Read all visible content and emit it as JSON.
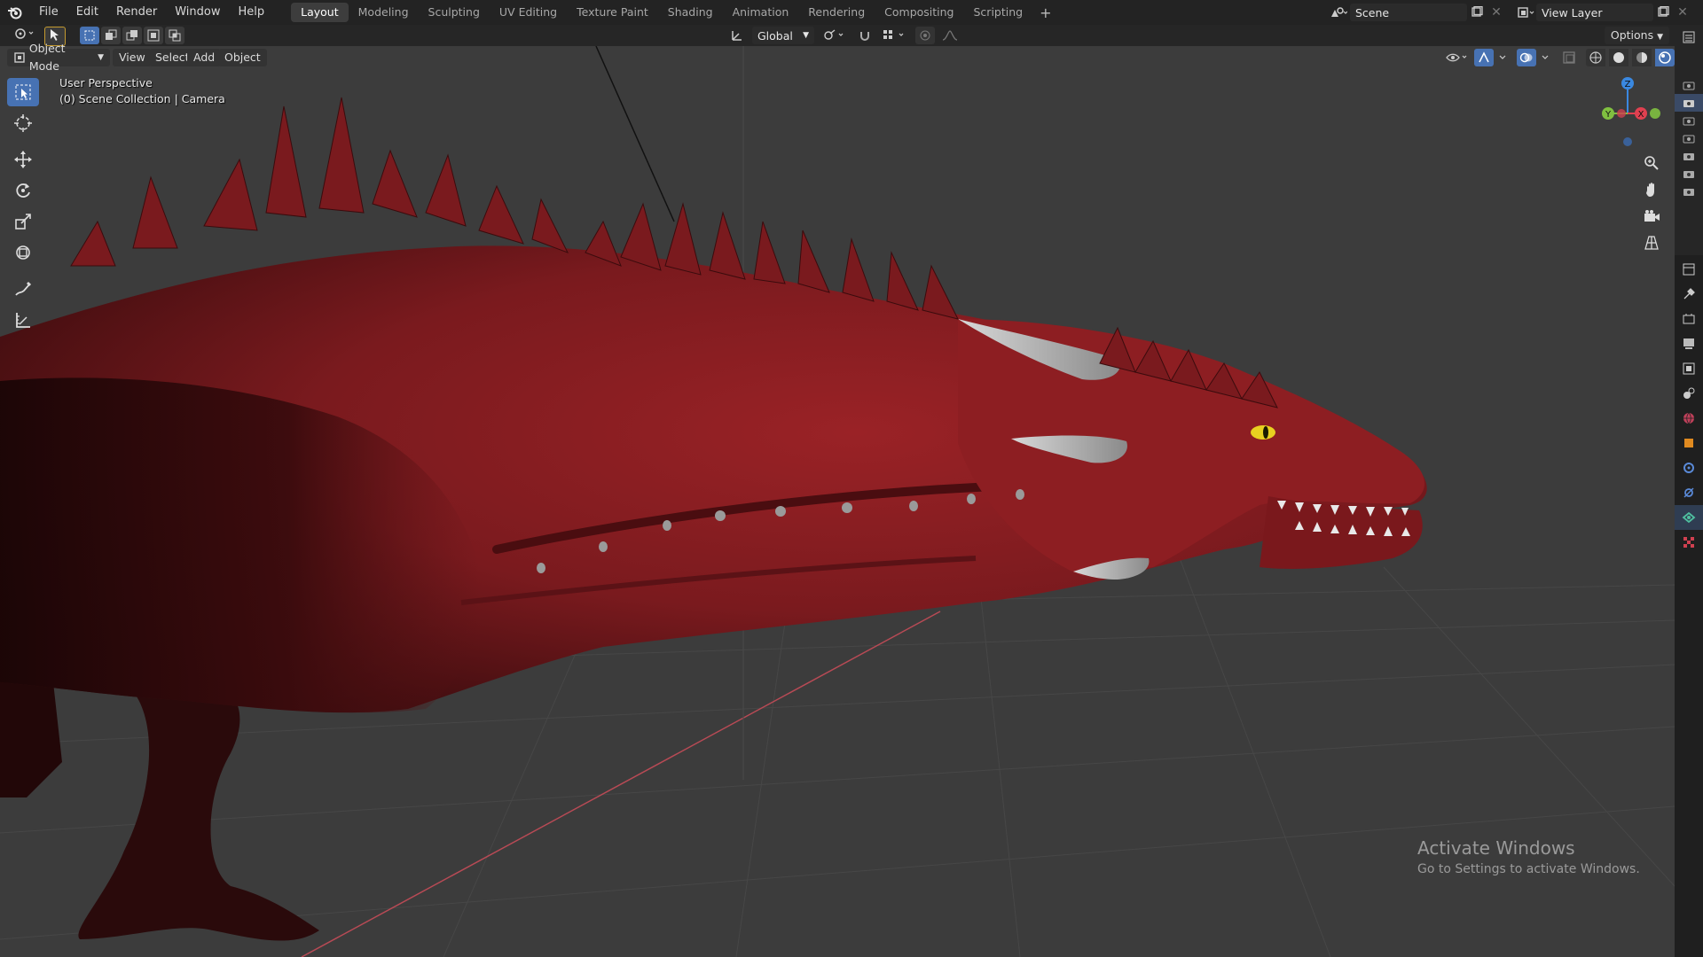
{
  "menus": [
    "File",
    "Edit",
    "Render",
    "Window",
    "Help"
  ],
  "workspace_tabs": [
    "Layout",
    "Modeling",
    "Sculpting",
    "UV Editing",
    "Texture Paint",
    "Shading",
    "Animation",
    "Rendering",
    "Compositing",
    "Scripting"
  ],
  "active_tab": "Layout",
  "scene_name": "Scene",
  "view_layer_name": "View Layer",
  "transform_orientation": "Global",
  "options_label": "Options",
  "viewport_header": {
    "mode": "Object Mode",
    "menus": [
      "View",
      "Select",
      "Add",
      "Object"
    ]
  },
  "viewport_info": {
    "line1": "User Perspective",
    "line2": "(0) Scene Collection | Camera"
  },
  "gizmo": {
    "z": "Z",
    "y": "Y",
    "x": "X"
  },
  "colors": {
    "accent": "#4772b3",
    "axis_x": "#e04050",
    "axis_y": "#80c040",
    "axis_z": "#3a88e0",
    "dragon_red": "#8b1c20"
  },
  "activation": {
    "title": "Activate Windows",
    "subtitle": "Go to Settings to activate Windows."
  }
}
